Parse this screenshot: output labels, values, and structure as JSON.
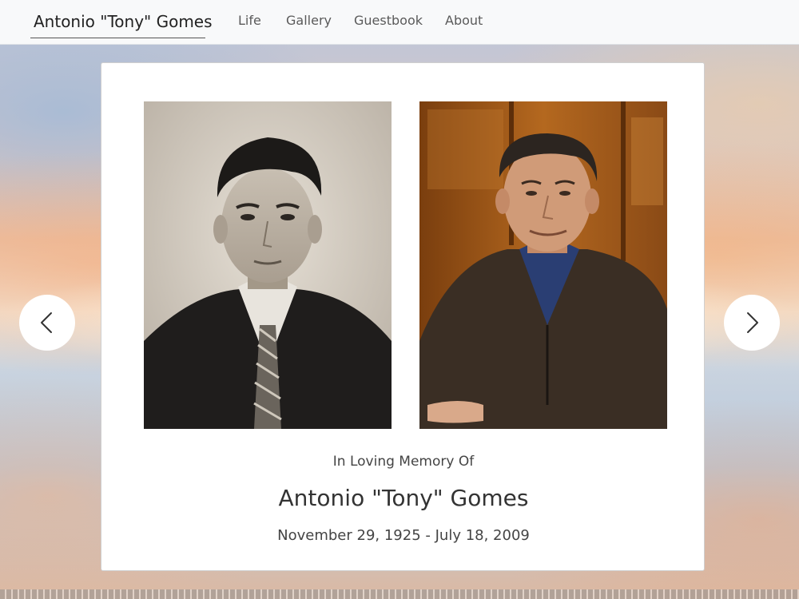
{
  "navbar": {
    "brand": "Antonio \"Tony\" Gomes",
    "links": [
      "Life",
      "Gallery",
      "Guestbook",
      "About"
    ]
  },
  "memorial": {
    "intro": "In Loving Memory Of",
    "name": "Antonio \"Tony\" Gomes",
    "dates": "November 29, 1925 - July 18, 2009"
  },
  "photos": [
    {
      "subject": "young-portrait-photo",
      "style": "black-and-white"
    },
    {
      "subject": "older-portrait-photo",
      "style": "color"
    }
  ],
  "carousel": {
    "prev_icon": "chevron-left-icon",
    "next_icon": "chevron-right-icon"
  },
  "colors": {
    "navbar_bg": "#f8f9fa",
    "card_bg": "#ffffff",
    "text": "#333333"
  }
}
